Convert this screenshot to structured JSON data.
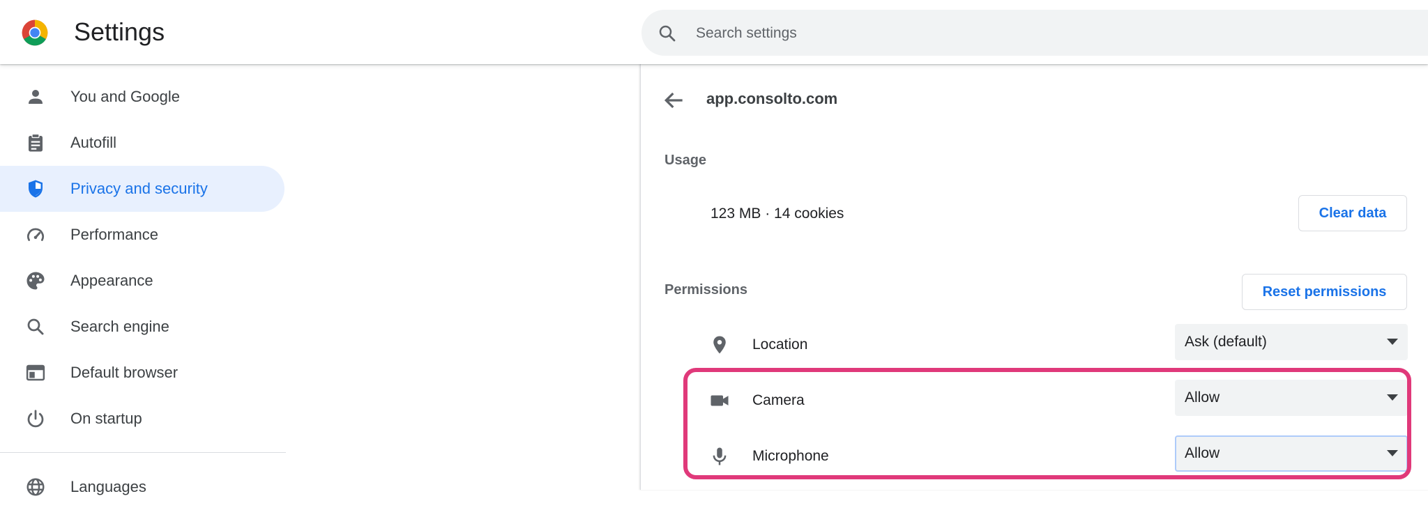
{
  "header": {
    "title": "Settings",
    "search_placeholder": "Search settings"
  },
  "sidebar": {
    "items": [
      {
        "label": "You and Google",
        "icon": "person-icon"
      },
      {
        "label": "Autofill",
        "icon": "clipboard-icon"
      },
      {
        "label": "Privacy and security",
        "icon": "shield-icon",
        "active": true
      },
      {
        "label": "Performance",
        "icon": "speedometer-icon"
      },
      {
        "label": "Appearance",
        "icon": "palette-icon"
      },
      {
        "label": "Search engine",
        "icon": "search-icon"
      },
      {
        "label": "Default browser",
        "icon": "browser-window-icon"
      },
      {
        "label": "On startup",
        "icon": "power-icon"
      },
      {
        "label": "Languages",
        "icon": "globe-icon"
      }
    ]
  },
  "site": {
    "name": "app.consolto.com",
    "usage_title": "Usage",
    "usage_text": "123 MB · 14 cookies",
    "clear_data_label": "Clear data",
    "permissions_title": "Permissions",
    "reset_permissions_label": "Reset permissions",
    "permissions": [
      {
        "label": "Location",
        "value": "Ask (default)",
        "icon": "location-pin-icon"
      },
      {
        "label": "Camera",
        "value": "Allow",
        "icon": "camera-icon"
      },
      {
        "label": "Microphone",
        "value": "Allow",
        "icon": "microphone-icon",
        "focused": true
      }
    ]
  },
  "colors": {
    "accent": "#1a73e8",
    "active_nav_bg": "#e8f0fe",
    "highlight": "#e0397a"
  }
}
